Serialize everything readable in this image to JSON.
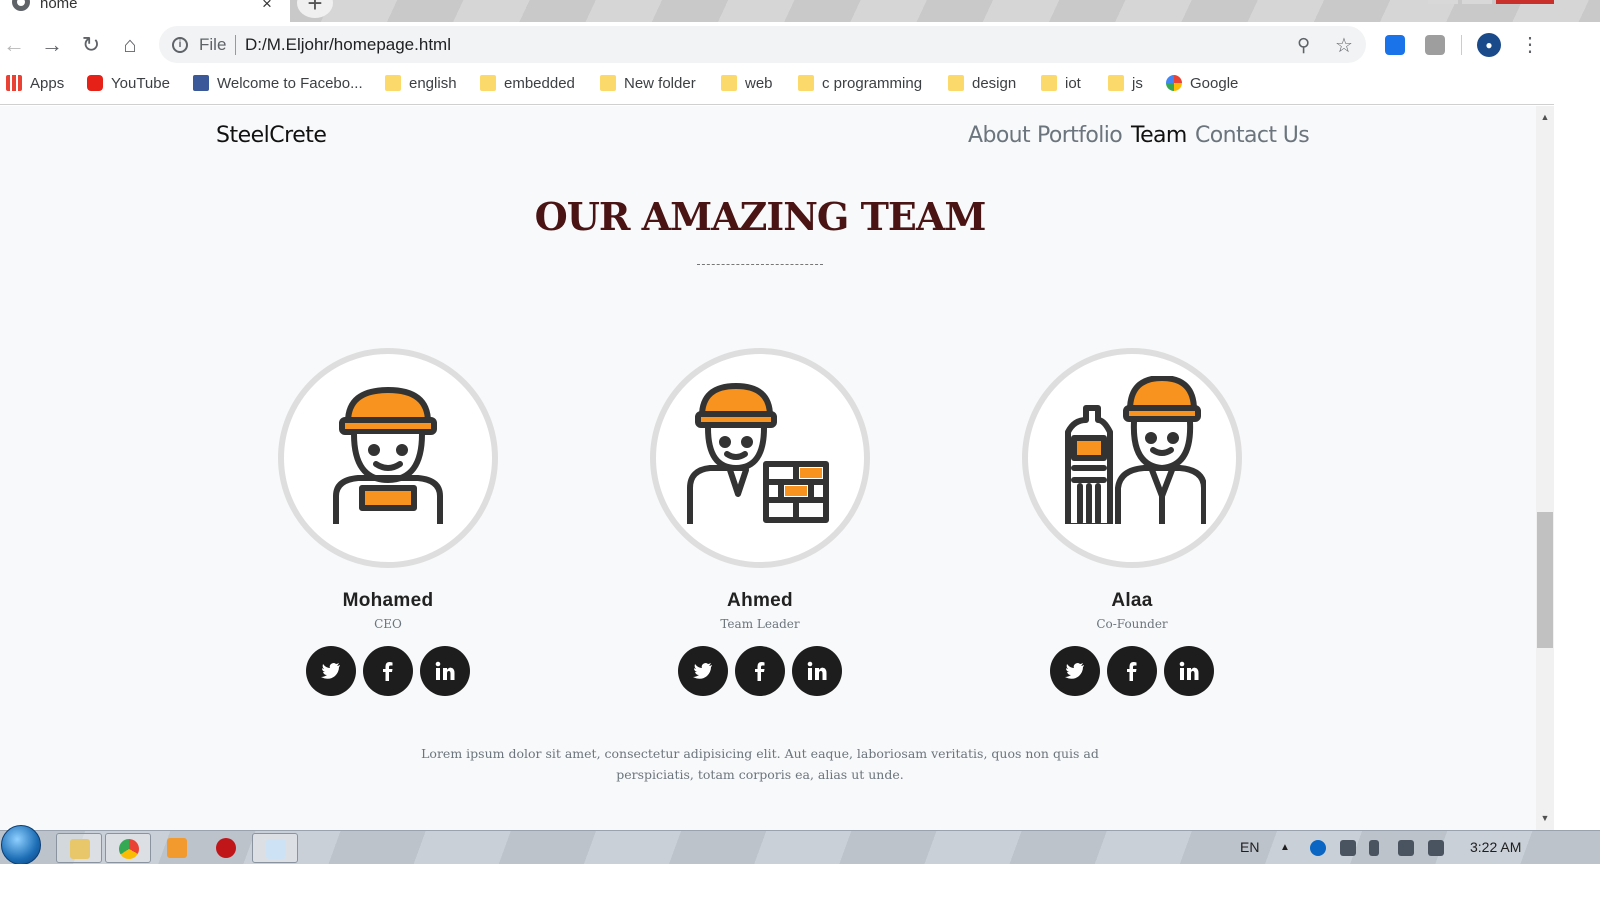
{
  "browser": {
    "tab_title": "home",
    "tab_close": "×",
    "new_tab": "+",
    "address_scheme": "File",
    "address_url": "D:/M.Eljohr/homepage.html",
    "bookmarks": [
      {
        "label": "Apps",
        "icon": "apps-grid-icon"
      },
      {
        "label": "YouTube",
        "icon": "youtube-icon"
      },
      {
        "label": "Welcome to Facebo...",
        "icon": "facebook-icon"
      },
      {
        "label": "english",
        "icon": "folder-icon"
      },
      {
        "label": "embedded",
        "icon": "folder-icon"
      },
      {
        "label": "New folder",
        "icon": "folder-icon"
      },
      {
        "label": "web",
        "icon": "folder-icon"
      },
      {
        "label": "c programming",
        "icon": "folder-icon"
      },
      {
        "label": "design",
        "icon": "folder-icon"
      },
      {
        "label": "iot",
        "icon": "folder-icon"
      },
      {
        "label": "js",
        "icon": "folder-icon"
      },
      {
        "label": "Google",
        "icon": "google-icon"
      }
    ]
  },
  "site": {
    "brand": "SteelCrete",
    "nav": [
      {
        "label": "About",
        "active": false
      },
      {
        "label": "Portfolio",
        "active": false
      },
      {
        "label": "Team",
        "active": true
      },
      {
        "label": "Contact Us",
        "active": false
      }
    ]
  },
  "team": {
    "title": "OUR AMAZING TEAM",
    "members": [
      {
        "name": "Mohamed",
        "role": "CEO",
        "avatar": "construction-worker-icon"
      },
      {
        "name": "Ahmed",
        "role": "Team Leader",
        "avatar": "worker-with-bricks-icon"
      },
      {
        "name": "Alaa",
        "role": "Co-Founder",
        "avatar": "engineer-with-building-icon"
      }
    ],
    "social": [
      "twitter-icon",
      "facebook-icon",
      "linkedin-icon"
    ],
    "footer": "Lorem ipsum dolor sit amet, consectetur adipisicing elit. Aut eaque, laboriosam veritatis, quos non quis ad perspiciatis, totam corporis ea, alias ut unde."
  },
  "taskbar": {
    "language": "EN",
    "clock": "3:22 AM"
  },
  "colors": {
    "title": "#4a1414",
    "helmet": "#f7931e",
    "outline": "#333333",
    "social_bg": "#1d1d1d",
    "page_bg": "#f8f9fa"
  }
}
